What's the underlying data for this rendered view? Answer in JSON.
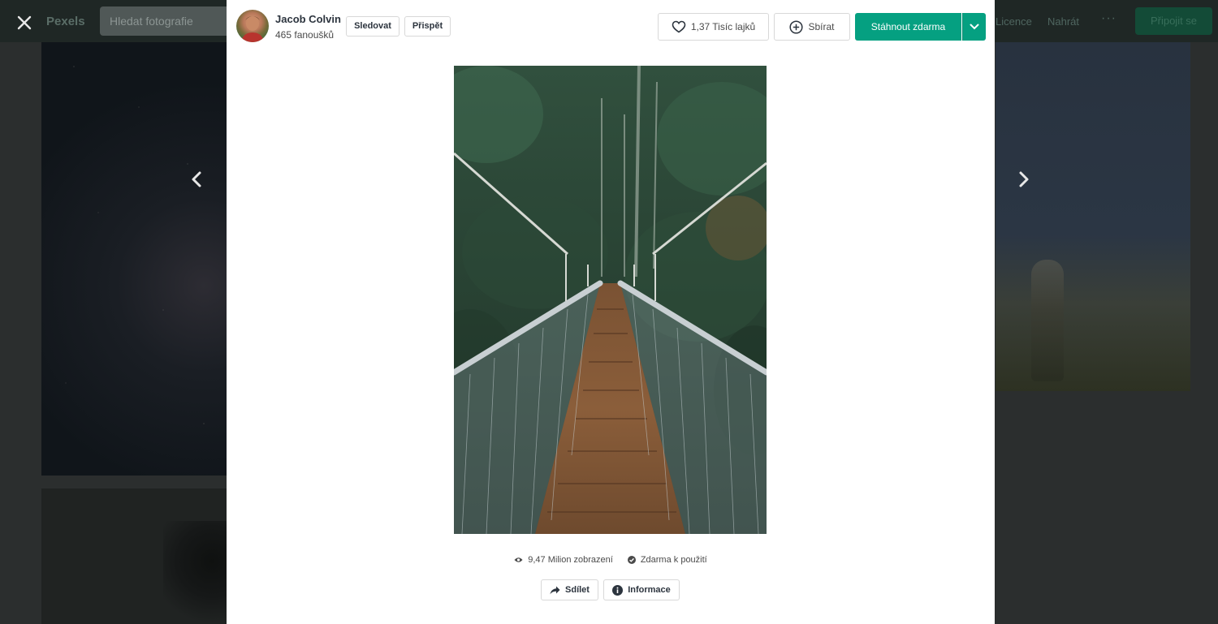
{
  "background": {
    "logo": "Pexels",
    "search_placeholder": "Hledat fotografie",
    "nav": [
      "Licence",
      "Nahrát"
    ],
    "more": "···",
    "join": "Připojit se"
  },
  "author": {
    "name": "Jacob Colvin",
    "fans": "465 fanoušků",
    "follow_label": "Sledovat",
    "donate_label": "Přispět"
  },
  "toolbar": {
    "likes_label": "1,37 Tisíc lajků",
    "collect_label": "Sbírat",
    "download_label": "Stáhnout zdarma"
  },
  "stats": {
    "views": "9,47 Milion zobrazení",
    "license": "Zdarma k použití"
  },
  "actions": {
    "share_label": "Sdílet",
    "info_label": "Informace"
  },
  "colors": {
    "accent": "#05a081",
    "overlay": "#2b2e2e"
  },
  "icons": [
    "close-icon",
    "chevron-left-icon",
    "chevron-right-icon",
    "heart-icon",
    "plus-circle-icon",
    "chevron-down-icon",
    "eye-icon",
    "check-circle-icon",
    "share-icon",
    "info-icon"
  ]
}
